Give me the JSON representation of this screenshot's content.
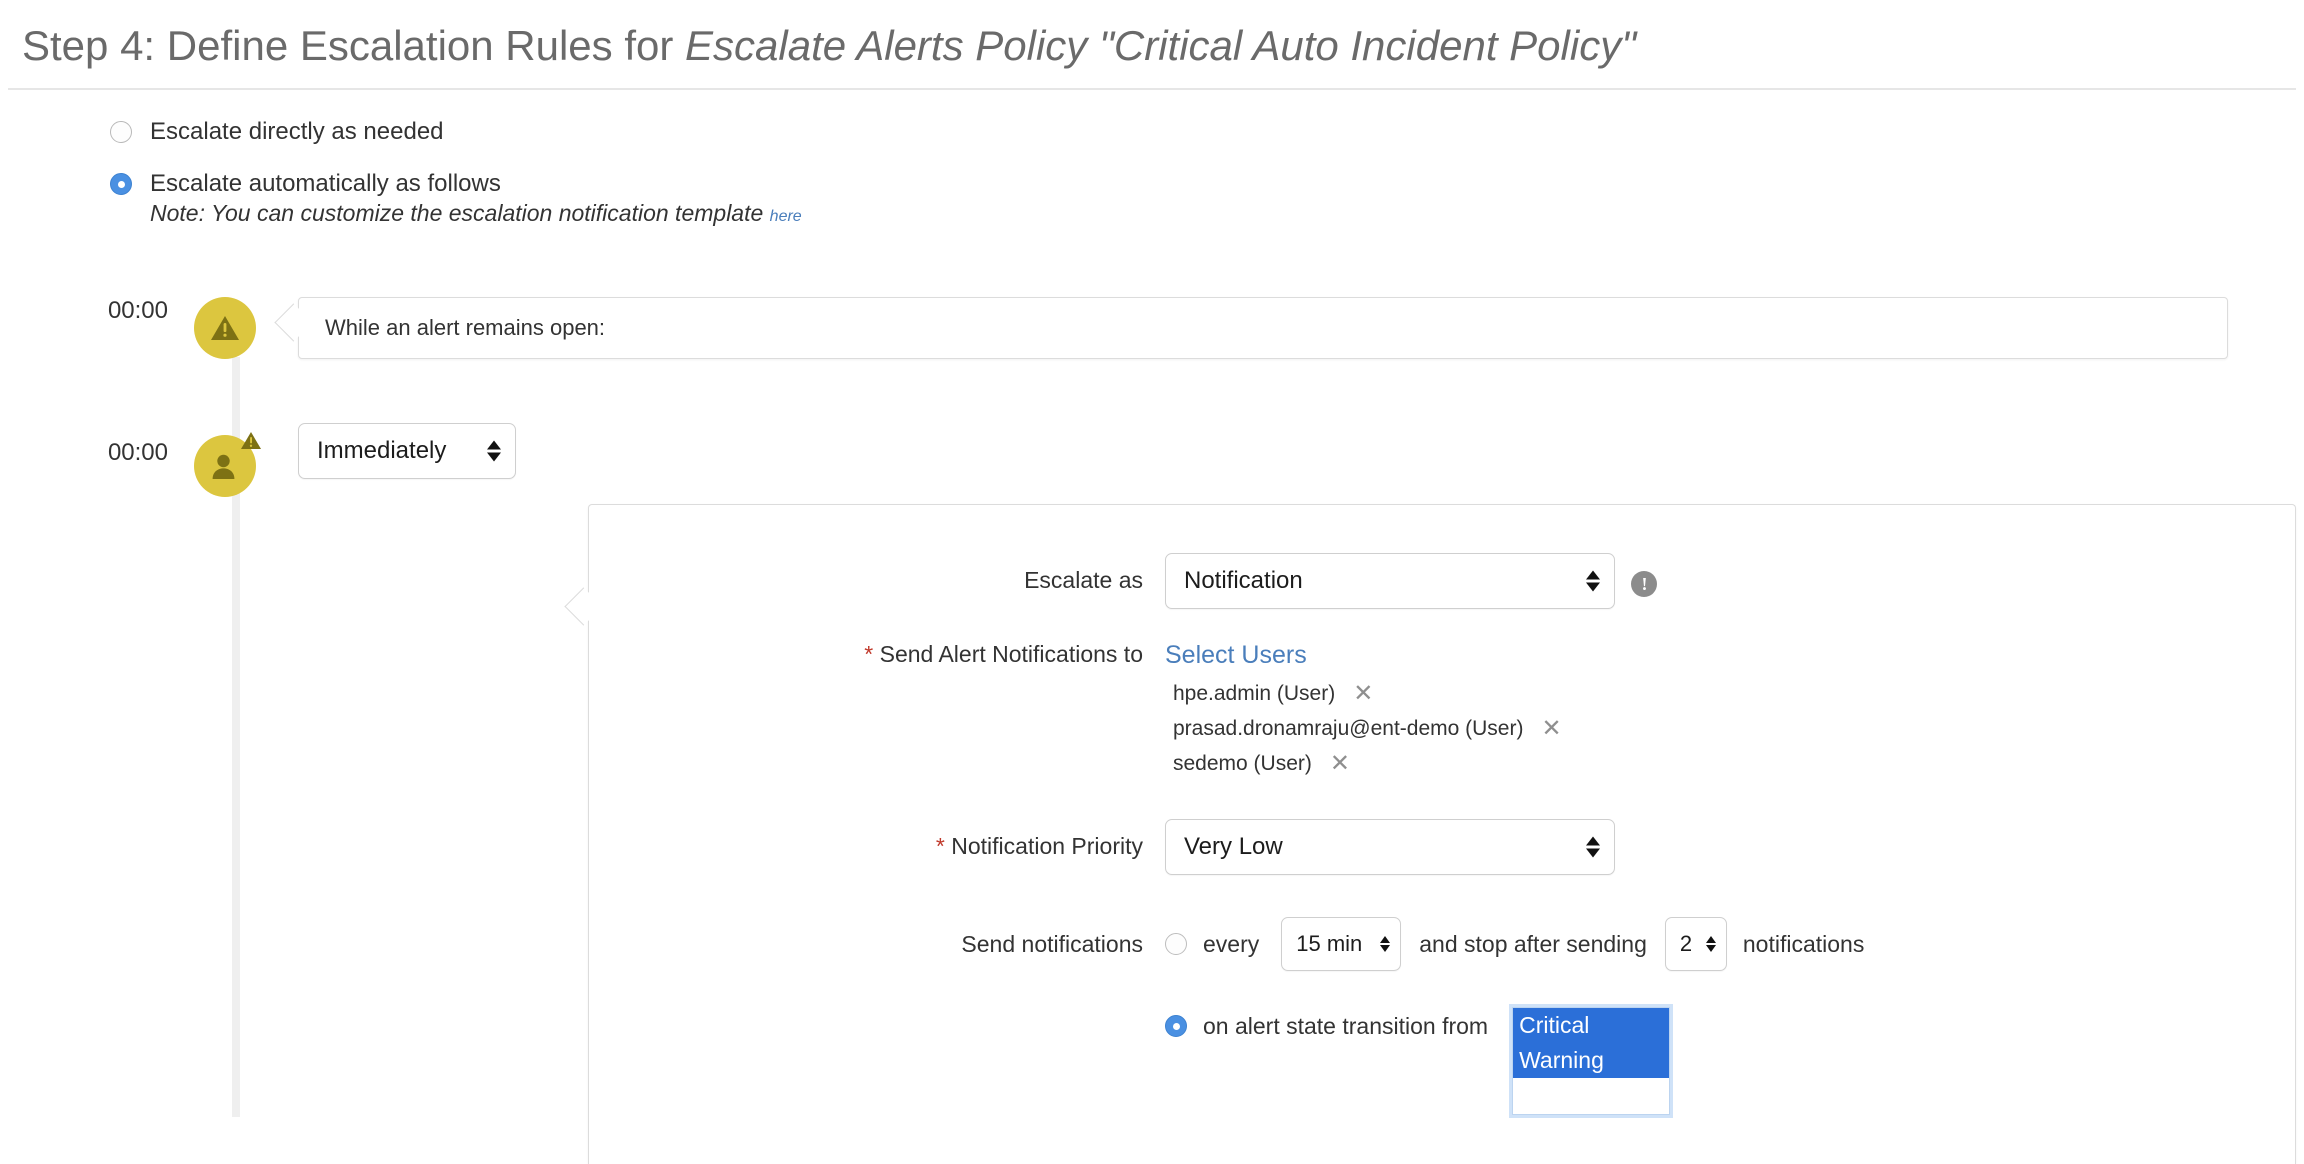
{
  "header": {
    "title_prefix": "Step 4: Define Escalation Rules for ",
    "policy_name": "Escalate Alerts Policy \"Critical Auto Incident Policy\""
  },
  "escalation_mode": {
    "option_manual": "Escalate directly as needed",
    "option_auto": "Escalate automatically as follows",
    "note_prefix": "Note: You can customize the escalation notification template ",
    "note_link": "here"
  },
  "timeline": {
    "row1": {
      "time": "00:00",
      "icon": "warning-triangle-icon",
      "bubble_text": "While an alert remains open:"
    },
    "row2": {
      "time": "00:00",
      "icon": "user-warning-icon",
      "delay_select_value": "Immediately"
    }
  },
  "form": {
    "escalate_as": {
      "label": "Escalate as",
      "value": "Notification",
      "info_icon": "info-exclamation-icon"
    },
    "send_alert_notifications_to": {
      "label_required_mark": "*",
      "label": "Send Alert Notifications to",
      "select_users_link": "Select Users",
      "recipients": [
        {
          "name": "hpe.admin (User)",
          "remove": "✕"
        },
        {
          "name": "prasad.dronamraju@ent-demo (User)",
          "remove": "✕"
        },
        {
          "name": "sedemo (User)",
          "remove": "✕"
        }
      ]
    },
    "notification_priority": {
      "label_required_mark": "*",
      "label": "Notification Priority",
      "value": "Very Low"
    },
    "send_notifications": {
      "label": "Send notifications",
      "every_option_label": "every",
      "interval_value": "15 min",
      "middle_text": "and stop after sending",
      "count_value": "2",
      "trailing_text": "notifications",
      "transition_option_label": "on alert state transition from",
      "states": [
        "Critical",
        "Warning"
      ],
      "states_selected": [
        "Critical",
        "Warning"
      ]
    }
  },
  "colors": {
    "accent_blue": "#4a90e2",
    "link_blue": "#4a7ebb",
    "selection_blue": "#2b6fd8",
    "marker_yellow": "#dcc63f",
    "marker_icon_olive": "#7d7114",
    "required_red": "#c0392b"
  }
}
